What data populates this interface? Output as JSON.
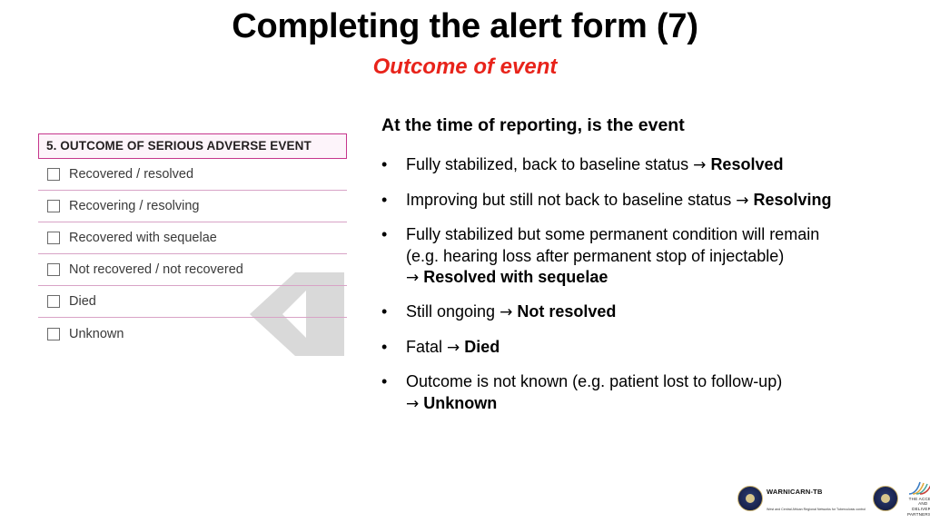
{
  "slide": {
    "title": "Completing the alert form (7)",
    "subtitle": "Outcome of event"
  },
  "form": {
    "header": "5. OUTCOME OF SERIOUS ADVERSE EVENT",
    "options": [
      "Recovered / resolved",
      "Recovering / resolving",
      "Recovered with sequelae",
      "Not recovered / not recovered",
      "Died",
      "Unknown"
    ]
  },
  "content": {
    "lead": "At the time of reporting, is the event",
    "bullet_marker": "•",
    "arrow": "→",
    "bullets": [
      {
        "text": "Fully stabilized, back to baseline status ",
        "arrow": "→",
        "bold": "Resolved",
        "extra": "",
        "line2": "",
        "line3": ""
      },
      {
        "text": "Improving but still not back to baseline status ",
        "arrow": "→",
        "bold": "Resolving",
        "extra": "",
        "line2": "",
        "line3": ""
      },
      {
        "text": "Fully stabilized but some permanent condition will remain",
        "arrow": "→",
        "bold": "Resolved with sequelae",
        "extra": "",
        "line2": "(e.g. hearing loss after permanent stop of injectable)",
        "line3": ""
      },
      {
        "text": "Still ongoing ",
        "arrow": "→",
        "bold": "Not resolved",
        "extra": "",
        "line2": "",
        "line3": ""
      },
      {
        "text": "Fatal ",
        "arrow": "→",
        "bold": "Died",
        "extra": "",
        "line2": "",
        "line3": ""
      },
      {
        "text": "Outcome is not known (e.g. patient lost to follow-up)",
        "arrow": "→",
        "bold": "Unknown",
        "extra": "",
        "line2": "",
        "line3": ""
      }
    ]
  },
  "footer": {
    "warnicarn_name": "WARNICARN-TB",
    "warnicarn_sub": "West and Central African Regional Networks for Tuberculosis control",
    "adp_line1": "THE ACCESS AND",
    "adp_line2": "DELIVERY PARTNERSHIP"
  },
  "colors": {
    "subtitle": "#e8231a",
    "form_border": "#c6368c",
    "form_rule": "#d8a3c6",
    "watermark": "#d9d9d9"
  }
}
